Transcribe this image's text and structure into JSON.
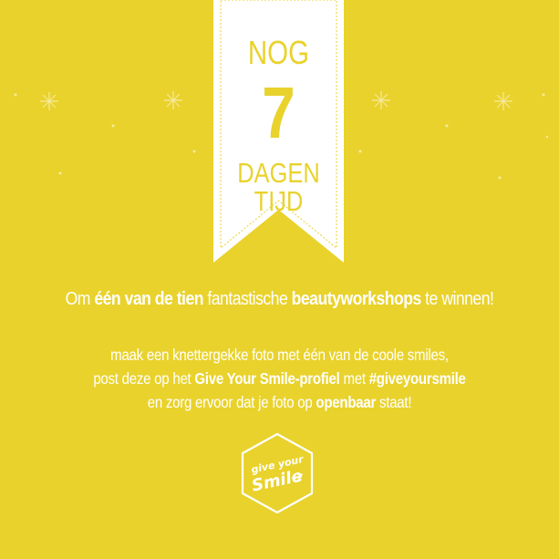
{
  "countdown": {
    "top_text": "NOG",
    "number": "7",
    "bottom_text": "DAGEN TIJD"
  },
  "headline": {
    "part1": "Om ",
    "bold1": "één van de tien",
    "part2": " fantastische ",
    "bold2": "beautyworkshops",
    "part3": " te winnen!"
  },
  "body": {
    "line1": "maak een knettergekke foto met één van de coole smiles,",
    "line2_a": "post deze op het ",
    "line2_b": "Give Your Smile-profiel",
    "line2_c": " met ",
    "line2_d": "#giveyoursmile",
    "line3_a": "en zorg ervoor dat je foto op ",
    "line3_b": "openbaar",
    "line3_c": " staat!"
  },
  "logo": {
    "top_text": "give your",
    "main_text": "Smile"
  },
  "colors": {
    "background": "#e9d22c",
    "banner": "#ffffff",
    "text": "#ffffff"
  }
}
